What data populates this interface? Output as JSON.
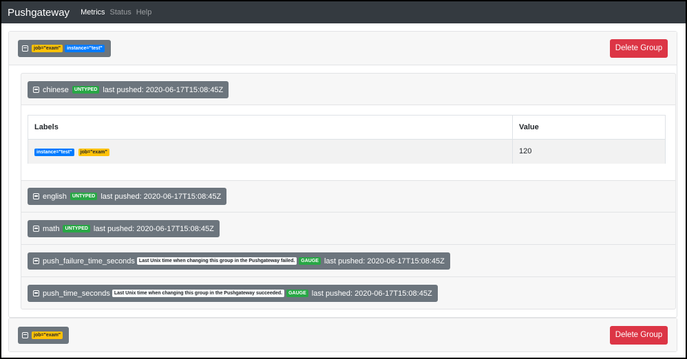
{
  "navbar": {
    "brand": "Pushgateway",
    "links": [
      {
        "label": "Metrics",
        "active": true
      },
      {
        "label": "Status",
        "active": false
      },
      {
        "label": "Help",
        "active": false
      }
    ]
  },
  "groups": [
    {
      "labels": [
        "job=\"exam\"",
        "instance=\"test\""
      ],
      "delete_label": "Delete Group",
      "metrics": [
        {
          "name": "chinese",
          "help": "",
          "type": "UNTYPED",
          "last_pushed": "last pushed: 2020-06-17T15:08:45Z"
        },
        {
          "name": "english",
          "help": "",
          "type": "UNTYPED",
          "last_pushed": "last pushed: 2020-06-17T15:08:45Z"
        },
        {
          "name": "math",
          "help": "",
          "type": "UNTYPED",
          "last_pushed": "last pushed: 2020-06-17T15:08:45Z"
        },
        {
          "name": "push_failure_time_seconds",
          "help": "Last Unix time when changing this group in the Pushgateway failed.",
          "type": "GAUGE",
          "last_pushed": "last pushed: 2020-06-17T15:08:45Z"
        },
        {
          "name": "push_time_seconds",
          "help": "Last Unix time when changing this group in the Pushgateway succeeded.",
          "type": "GAUGE",
          "last_pushed": "last pushed: 2020-06-17T15:08:45Z"
        }
      ],
      "table": {
        "headers": [
          "Labels",
          "Value"
        ],
        "rows": [
          {
            "labels": [
              "instance=\"test\"",
              "job=\"exam\""
            ],
            "value": "120"
          }
        ]
      }
    },
    {
      "labels": [
        "job=\"exam\""
      ],
      "delete_label": "Delete Group"
    }
  ],
  "colors": {
    "navbar": "#343a40",
    "job_badge": "#ffc107",
    "instance_badge": "#007bff",
    "type_badge": "#28a745",
    "danger": "#dc3545",
    "toggle": "#6c757d"
  },
  "icons": {
    "toggle": "minus-square-icon"
  }
}
